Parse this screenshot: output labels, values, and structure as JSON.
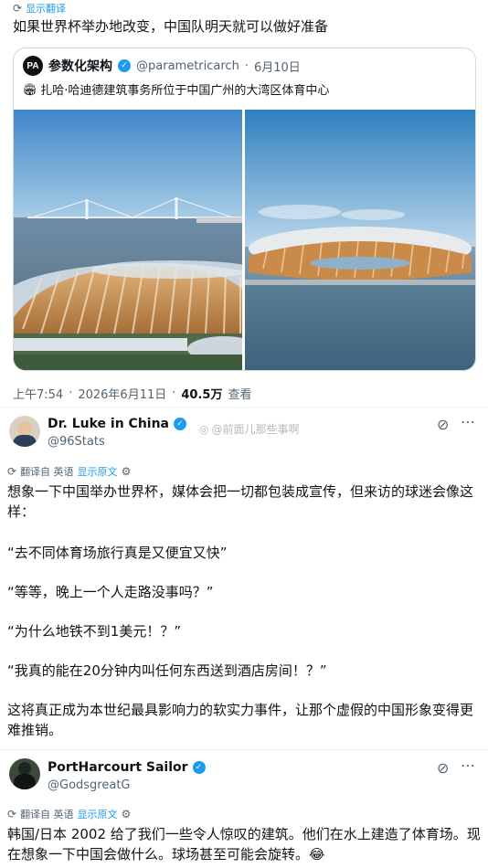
{
  "top": {
    "translate_label": "显示翻译",
    "tweet_text": "如果世界杯举办地改变，中国队明天就可以做好准备"
  },
  "quote": {
    "avatar_text": "PA",
    "name": "参数化架构",
    "handle": "@parametricarch",
    "date": "6月10日",
    "text": "扎哈·哈迪德建筑事务所位于中国广州的大湾区体育中心"
  },
  "meta": {
    "time": "上午7:54",
    "date": "2026年6月11日",
    "views": "40.5万",
    "views_label": "查看"
  },
  "reply1": {
    "name": "Dr. Luke in China",
    "handle": "@96Stats",
    "watermark": "@前面儿那些事啊",
    "translated_from": "翻译自 英语",
    "show_original": "显示原文",
    "paragraphs": [
      "想象一下中国举办世界杯，媒体会把一切都包装成宣传，但来访的球迷会像这样：",
      "“去不同体育场旅行真是又便宜又快”",
      "“等等，晚上一个人走路没事吗？”",
      "“为什么地铁不到1美元！？”",
      "“我真的能在20分钟内叫任何东西送到酒店房间！？”",
      "这将真正成为本世纪最具影响力的软实力事件，让那个虚假的中国形象变得更难推销。"
    ]
  },
  "reply2": {
    "name": "PortHarcourt Sailor",
    "handle": "@GodsgreatG",
    "translated_from": "翻译自 英语",
    "show_original": "显示原文",
    "text": "韩国/日本 2002 给了我们一些令人惊叹的建筑。他们在水上建造了体育场。现在想象一下中国会做什么。球场甚至可能会旋转。😂"
  },
  "colors": {
    "accent": "#1d9bf0",
    "secondary_text": "#536471",
    "border": "#cfd9de"
  }
}
